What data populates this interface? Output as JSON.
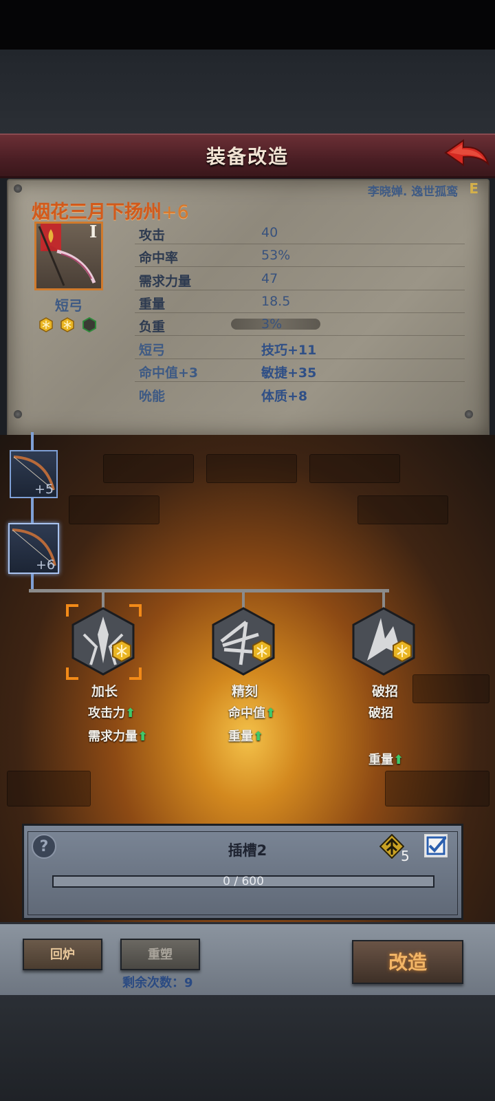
{
  "header": {
    "title": "装备改造",
    "back_icon": "red-arrow-back-icon"
  },
  "equipment": {
    "owner": "李晓婵. 逸世孤鸾",
    "owner_grade": "E",
    "name": "烟花三月下扬州",
    "plus": "+6",
    "tier": "I",
    "type": "短弓",
    "gems": [
      {
        "state": "filled",
        "icon": "gold-gem-icon"
      },
      {
        "state": "filled",
        "icon": "gold-gem-icon"
      },
      {
        "state": "empty",
        "icon": "empty-gem-slot-icon"
      }
    ],
    "stats": [
      {
        "label": "攻击",
        "value": "40"
      },
      {
        "label": "命中率",
        "value": "53%"
      },
      {
        "label": "需求力量",
        "value": "47"
      },
      {
        "label": "重量",
        "value": "18.5"
      },
      {
        "label": "负重",
        "value": "3%"
      },
      {
        "label": "短弓",
        "value": "技巧+11"
      },
      {
        "label": "命中值+3",
        "value": "敏捷+35"
      },
      {
        "label": "吮能",
        "value": "体质+8"
      }
    ]
  },
  "history": [
    {
      "level": "+5"
    },
    {
      "level": "+6"
    }
  ],
  "options": [
    {
      "name": "加长",
      "lines": [
        "攻击力",
        "需求力量"
      ],
      "arrows": [
        true,
        true
      ],
      "selected": true,
      "icon": "spear-hex-icon"
    },
    {
      "name": "精刻",
      "lines": [
        "命中值",
        "重量"
      ],
      "arrows": [
        true,
        true
      ],
      "selected": false,
      "icon": "arrow-fan-hex-icon"
    },
    {
      "name": "破招",
      "lines": [
        "破招",
        "",
        "重量"
      ],
      "arrows": [
        false,
        false,
        true
      ],
      "selected": false,
      "icon": "broken-blade-hex-icon"
    }
  ],
  "socket": {
    "title": "插槽2",
    "rune_count": "5",
    "checked": true,
    "progress_text": "0 / 600",
    "progress": 0
  },
  "actions": {
    "recast": "回炉",
    "reshape": "重塑",
    "remaining": "剩余次数：9",
    "modify": "改造"
  },
  "colors": {
    "accent": "#d15a1c",
    "stat_value": "#38527d",
    "up_arrow": "#3fc86a",
    "banner": "#5a242a"
  }
}
